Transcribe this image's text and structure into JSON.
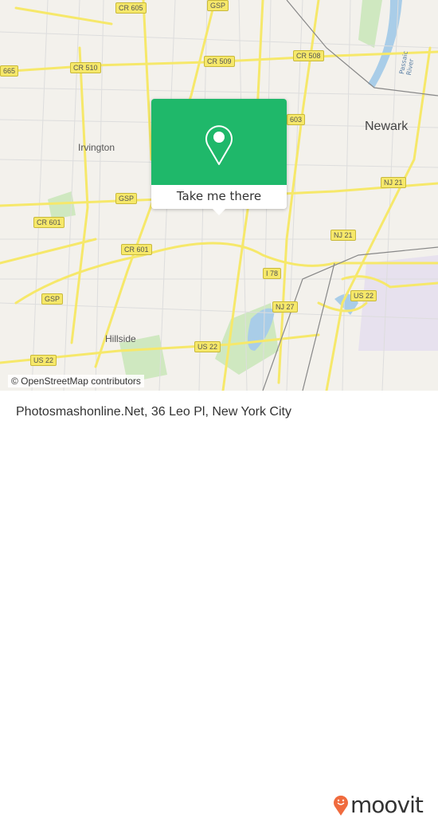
{
  "map": {
    "attribution": "© OpenStreetMap contributors",
    "places": [
      {
        "label": "Irvington",
        "size": "normal"
      },
      {
        "label": "Newark",
        "size": "big"
      },
      {
        "label": "Hillside",
        "size": "normal"
      }
    ],
    "road_labels": [
      "CR 605",
      "GSP",
      "CR 509",
      "CR 508",
      "665",
      "CR 510",
      "603",
      "NJ 21",
      "GSP",
      "CR 601",
      "NJ 21",
      "CR 601",
      "I 78",
      "GSP",
      "US 22",
      "NJ 27",
      "US 22",
      "US 22"
    ],
    "water_label": "Passaic River",
    "colors": {
      "land": "#f3f1ec",
      "road_major": "#f6e86a",
      "park": "#cfe8c0",
      "water": "#a9cde8",
      "popup": "#1fb86a"
    }
  },
  "popup": {
    "icon": "map-pin-icon",
    "button_label": "Take me there"
  },
  "footer": {
    "title": "Photosmashonline.Net, 36 Leo Pl, New York City",
    "brand": "moovit",
    "brand_color": "#f06b3e"
  }
}
